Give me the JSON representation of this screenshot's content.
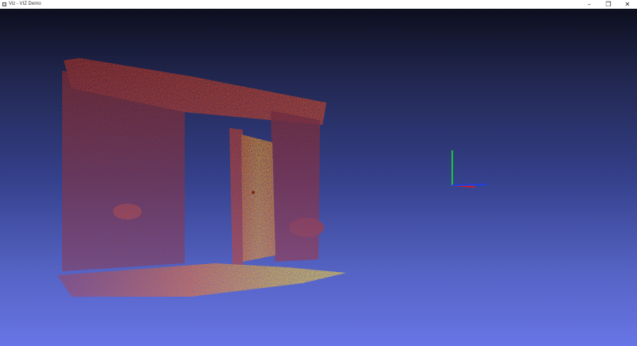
{
  "window": {
    "title": "Viz - VIZ Demo",
    "controls": {
      "minimize_icon": "minimize-icon",
      "maximize_icon": "restore-icon",
      "close_icon": "close-icon"
    }
  },
  "viewport": {
    "background_top": "#0d0f1e",
    "background_bottom": "#6875e6",
    "scene": "point-cloud",
    "point_colors": [
      "#b02418",
      "#e04020",
      "#ff8a10",
      "#ffd020"
    ],
    "axes": {
      "x_color": "#d02020",
      "y_color": "#20c040",
      "z_color": "#2040e0"
    }
  }
}
